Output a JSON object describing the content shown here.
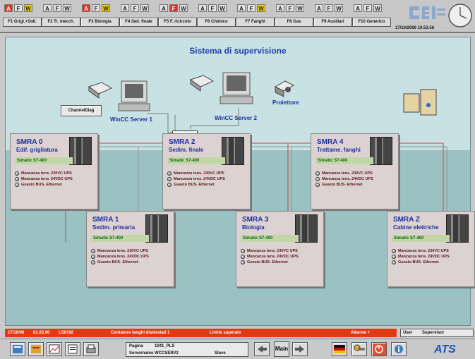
{
  "topbar": {
    "groups": [
      {
        "label": "F1 Grigl.+Soll.",
        "alarm": "red",
        "fault": "none",
        "warn": "yel"
      },
      {
        "label": "F2 Tr. mecch.",
        "alarm": "none",
        "fault": "none",
        "warn": "none"
      },
      {
        "label": "F3 Biologia",
        "alarm": "red",
        "fault": "none",
        "warn": "yel"
      },
      {
        "label": "F4 Sed. finale",
        "alarm": "none",
        "fault": "none",
        "warn": "none"
      },
      {
        "label": "F5 F. ricircolo",
        "alarm": "none",
        "fault": "red",
        "warn": "none"
      },
      {
        "label": "F6 Chimico",
        "alarm": "none",
        "fault": "none",
        "warn": "none"
      },
      {
        "label": "F7 Fanghi",
        "alarm": "none",
        "fault": "none",
        "warn": "yel"
      },
      {
        "label": "F8 Gas",
        "alarm": "none",
        "fault": "none",
        "warn": "none"
      },
      {
        "label": "F9 Ausiliari",
        "alarm": "none",
        "fault": "none",
        "warn": "none"
      },
      {
        "label": "F10 Generico",
        "alarm": "none",
        "fault": "none",
        "warn": "none"
      }
    ],
    "afw": [
      "A",
      "F",
      "W"
    ],
    "logo": "cei",
    "datetime": "17/10/2006 10.53.56"
  },
  "main": {
    "title": "Sistema di supervisione",
    "server1": "WinCC Server 1",
    "server2": "WinCC Server 2",
    "projector": "Proiettore",
    "channel_diag": "ChannelDiag",
    "panels": [
      {
        "name": "SMRA 0",
        "sub": "Edif. grigliatura",
        "plc": "Simatic S7-400"
      },
      {
        "name": "SMRA 1",
        "sub": "Sedim. primaria",
        "plc": "Simatic S7-400"
      },
      {
        "name": "SMRA 2",
        "sub": "Sedim. finale",
        "plc": "Simatic S7-400"
      },
      {
        "name": "SMRA 3",
        "sub": "Biologia",
        "plc": "Simatic S7-400"
      },
      {
        "name": "SMRA 4",
        "sub": "Trattame. fanghi",
        "plc": "Simatic S7-400"
      },
      {
        "name": "SMRA Z",
        "sub": "Cabine elettriche",
        "plc": "Simatic S7-400"
      }
    ],
    "alarms": [
      "Mancanza tens. 230VC UPS",
      "Mancanza tens. 24VDC UPS",
      "Guasto BUS- Ethernet"
    ]
  },
  "status": {
    "date": "17/10/06",
    "time": "01.03.00",
    "code": "LS0192",
    "message": "Contatore fanghi disidratati 1",
    "state": "Limite superato",
    "type": "Allarme +",
    "user_label": "User",
    "user": "Supervisor"
  },
  "bottom": {
    "page_label": "Pagina",
    "page": "1041_PLS",
    "server_label": "Servername",
    "server": "WCCSERV2",
    "role": "Slave",
    "main_label": "Main",
    "brand": "ATS",
    "colors": {
      "accent": "#1a56b8",
      "status": "#e03a12"
    }
  }
}
